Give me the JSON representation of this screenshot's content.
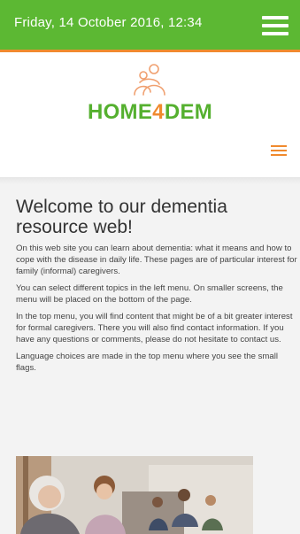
{
  "topbar": {
    "datetime": "Friday, 14 October 2016, 12:34",
    "menu_icon": "hamburger-icon"
  },
  "logo": {
    "text_prefix": "HOME",
    "text_accent": "4",
    "text_suffix": "DEM",
    "icon": "family-figures-icon"
  },
  "secondary_menu_icon": "hamburger-icon",
  "colors": {
    "brand_green": "#5cb833",
    "brand_orange": "#f08a2e"
  },
  "content": {
    "title": "Welcome to our dementia resource web!",
    "paragraphs": [
      "On this web site you can learn about dementia: what it means and how to cope with the disease in daily life. These pages are of particular interest for family (informal) caregivers.",
      "You can select different topics in the left menu. On smaller screens, the menu will be placed on the bottom of the page.",
      "In the top menu, you will find content that might be of a bit greater interest for formal caregivers. There you will also find contact information. If you have any questions or comments, please do not hesitate to contact us.",
      "Language choices are made in the top menu where you see the small flags."
    ]
  }
}
